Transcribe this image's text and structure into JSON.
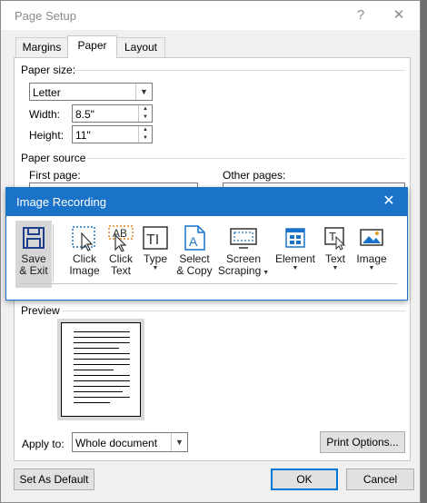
{
  "dialog": {
    "title": "Page Setup",
    "help_glyph": "?",
    "close_glyph": "✕",
    "tabs": [
      {
        "label": "Margins"
      },
      {
        "label": "Paper"
      },
      {
        "label": "Layout"
      }
    ],
    "paper_size": {
      "group_label": "Paper size:",
      "selected": "Letter",
      "width_label": "Width:",
      "width_value": "8.5\"",
      "height_label": "Height:",
      "height_value": "11\""
    },
    "paper_source": {
      "group_label": "Paper source",
      "first_page_label": "First page:",
      "other_pages_label": "Other pages:"
    },
    "preview": {
      "label": "Preview"
    },
    "apply_to": {
      "label": "Apply to:",
      "selected": "Whole document"
    },
    "buttons": {
      "print_options": "Print Options...",
      "set_default": "Set As Default",
      "ok": "OK",
      "cancel": "Cancel"
    }
  },
  "recording": {
    "title": "Image Recording",
    "close_glyph": "✕",
    "accent": "#1a73c9",
    "tools": [
      {
        "line1": "Save",
        "line2": "& Exit",
        "icon": "floppy-disk-icon"
      },
      {
        "line1": "Click",
        "line2": "Image",
        "icon": "click-image-icon"
      },
      {
        "line1": "Click",
        "line2": "Text",
        "icon": "click-text-icon"
      },
      {
        "line1": "Type",
        "line2": "",
        "icon": "type-icon"
      },
      {
        "line1": "Select",
        "line2": "& Copy",
        "icon": "select-copy-icon"
      },
      {
        "line1": "Screen",
        "line2": "Scraping",
        "icon": "screen-scraping-icon"
      },
      {
        "line1": "Element",
        "line2": "",
        "icon": "element-icon"
      },
      {
        "line1": "Text",
        "line2": "",
        "icon": "text-icon"
      },
      {
        "line1": "Image",
        "line2": "",
        "icon": "image-icon"
      }
    ]
  }
}
